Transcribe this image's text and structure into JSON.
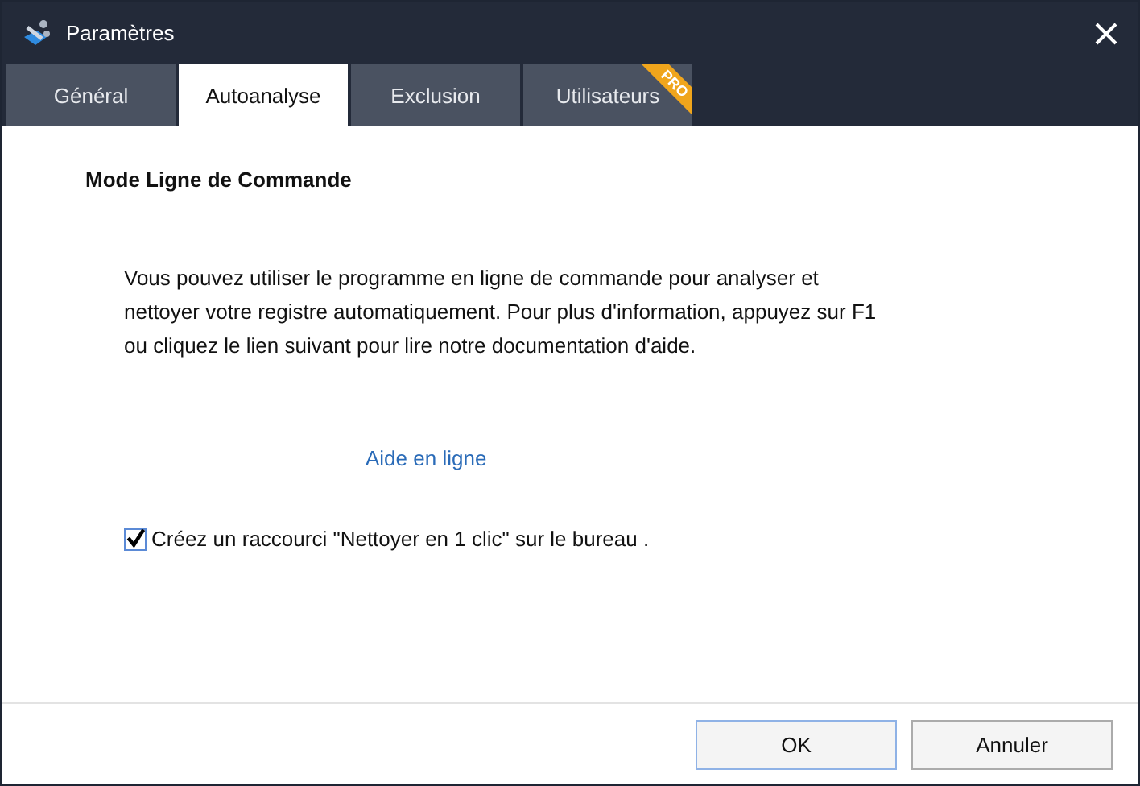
{
  "window": {
    "title": "Paramètres"
  },
  "tabs": [
    {
      "label": "Général",
      "selected": false
    },
    {
      "label": "Autoanalyse",
      "selected": true
    },
    {
      "label": "Exclusion",
      "selected": false
    },
    {
      "label": "Utilisateurs",
      "selected": false,
      "badge": "PRO"
    }
  ],
  "section": {
    "heading": "Mode Ligne de Commande",
    "description": "Vous pouvez utiliser le programme en ligne de commande pour analyser et nettoyer votre registre automatiquement. Pour plus d'information, appuyez sur F1 ou cliquez le lien suivant pour lire notre documentation d'aide.",
    "link": "Aide en ligne",
    "checkbox": {
      "label": "Créez un raccourci \"Nettoyer en 1 clic\" sur le bureau .",
      "checked": true
    }
  },
  "buttons": [
    {
      "label": "OK",
      "default": true
    },
    {
      "label": "Annuler",
      "default": false
    }
  ]
}
